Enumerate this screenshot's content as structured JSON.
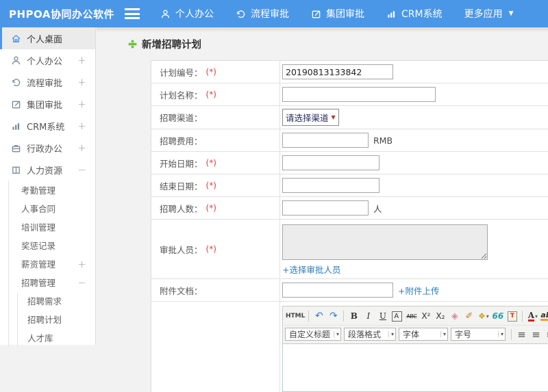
{
  "topbar": {
    "brand": "PHPOA协同办公软件",
    "nav": [
      {
        "label": "个人办公"
      },
      {
        "label": "流程审批"
      },
      {
        "label": "集团审批"
      },
      {
        "label": "CRM系统"
      },
      {
        "label": "更多应用"
      }
    ],
    "more_caret": "▼"
  },
  "sidebar": {
    "items": [
      {
        "label": "个人桌面",
        "active": true
      },
      {
        "label": "个人办公",
        "toggle": "+"
      },
      {
        "label": "流程审批",
        "toggle": "+"
      },
      {
        "label": "集团审批",
        "toggle": "+"
      },
      {
        "label": "CRM系统",
        "toggle": "+"
      },
      {
        "label": "行政办公",
        "toggle": "+"
      },
      {
        "label": "人力资源",
        "toggle": "−"
      }
    ],
    "hr_submenu": [
      {
        "label": "考勤管理"
      },
      {
        "label": "人事合同"
      },
      {
        "label": "培训管理"
      },
      {
        "label": "奖惩记录"
      },
      {
        "label": "薪资管理",
        "toggle": "+"
      },
      {
        "label": "招聘管理",
        "toggle": "−"
      }
    ],
    "recruit_submenu": [
      {
        "label": "招聘需求"
      },
      {
        "label": "招聘计划"
      },
      {
        "label": "人才库"
      }
    ]
  },
  "main": {
    "title": "新增招聘计划",
    "form": {
      "required_mark": "(*)",
      "rows": [
        {
          "label": "计划编号：",
          "value": "20190813133842"
        },
        {
          "label": "计划名称：",
          "value": ""
        },
        {
          "label": "招聘渠道：",
          "select_value": "请选择渠道"
        },
        {
          "label": "招聘费用：",
          "value": "",
          "suffix": "RMB"
        },
        {
          "label": "开始日期：",
          "value": ""
        },
        {
          "label": "结束日期：",
          "value": ""
        },
        {
          "label": "招聘人数：",
          "value": "",
          "suffix": "人"
        },
        {
          "label": "审批人员：",
          "link": "+选择审批人员"
        },
        {
          "label": "附件文档：",
          "value": "",
          "link": "+附件上传"
        }
      ]
    },
    "editor": {
      "source_label": "HTML",
      "icons": {
        "undo": "↶",
        "redo": "↷",
        "bold": "B",
        "italic": "I",
        "underline": "U",
        "fontbox": "A",
        "strike": "ABC",
        "sup": "X²",
        "sub": "X₂",
        "eraser": "◈",
        "brush": "✐",
        "paint": "❖",
        "quote": "66",
        "paste": "T",
        "fontcolor": "A",
        "highlight": "ab",
        "align": "≡",
        "link": "∞",
        "caret": "▾"
      },
      "dropdowns": [
        {
          "label": "自定义标题"
        },
        {
          "label": "段落格式"
        },
        {
          "label": "字体"
        },
        {
          "label": "字号"
        }
      ]
    }
  },
  "colors": {
    "topbar_blue": "#4a97e8",
    "link_blue": "#2e7bbf",
    "required_red": "#e03c3c",
    "accent_green": "#6fbf3a"
  }
}
